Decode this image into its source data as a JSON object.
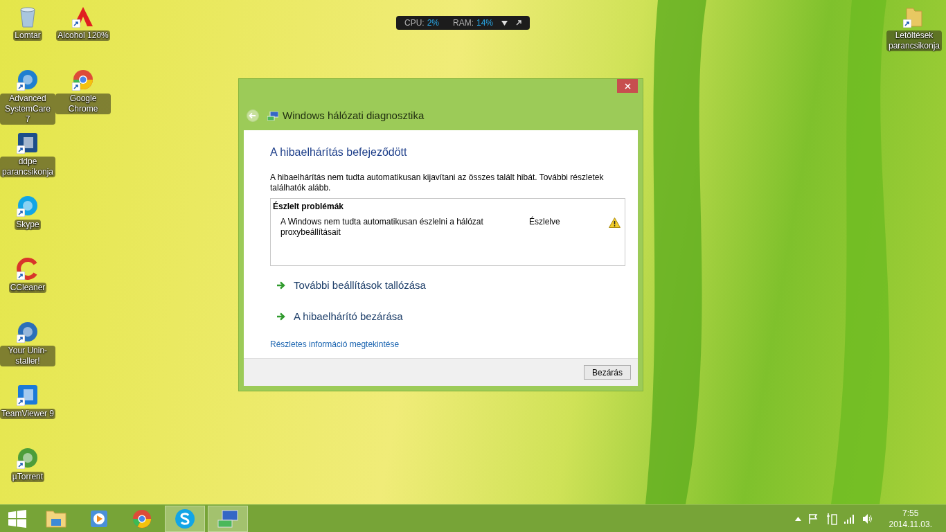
{
  "desktop": {
    "icon_columns": [
      [
        {
          "label": "Lomtar",
          "kind": "bin",
          "color": "#a9c6de",
          "shortcut": false
        },
        {
          "label": "Advanced SystemCare 7",
          "kind": "circle",
          "color": "#1f7fd0",
          "shortcut": true
        },
        {
          "label": "ddpe parancsikonja",
          "kind": "square",
          "color": "#1d4f8a",
          "shortcut": true
        },
        {
          "label": "Skype",
          "kind": "circle",
          "color": "#12a5e6",
          "shortcut": true
        },
        {
          "label": "CCleaner",
          "kind": "ring",
          "color": "#d8352a",
          "shortcut": true
        },
        {
          "label": "Your Unin-staller!",
          "kind": "circle",
          "color": "#2b6fb8",
          "shortcut": true
        },
        {
          "label": "TeamViewer 9",
          "kind": "square",
          "color": "#1c7ad8",
          "shortcut": true
        },
        {
          "label": "µTorrent",
          "kind": "circle",
          "color": "#4c9d3a",
          "shortcut": true
        }
      ],
      [
        {
          "label": "Alcohol 120%",
          "kind": "letter",
          "color": "#e02020",
          "shortcut": true
        },
        {
          "label": "Google Chrome",
          "kind": "chrome",
          "color": "#dd4b39",
          "shortcut": true
        }
      ]
    ],
    "right_icons": [
      {
        "label": "Letöltések parancsikonja",
        "kind": "folder",
        "color": "#e8c862",
        "shortcut": true
      }
    ]
  },
  "monitor": {
    "cpu_label": "CPU:",
    "cpu_value": "2%",
    "ram_label": "RAM:",
    "ram_value": "14%"
  },
  "window": {
    "title": "Windows hálózati diagnosztika",
    "heading": "A hibaelhárítás befejeződött",
    "message": "A hibaelhárítás nem tudta automatikusan kijavítani az összes talált hibát. További részletek találhatók alább.",
    "problems": {
      "header": "Észlelt problémák",
      "rows": [
        {
          "text": "A Windows nem tudta automatikusan észlelni a hálózat proxybeállításait",
          "status": "Észlelve"
        }
      ]
    },
    "options": [
      "További beállítások tallózása",
      "A hibaelhárító bezárása"
    ],
    "details_link": "Részletes információ megtekintése",
    "buttons": [
      "Bezárás"
    ]
  },
  "taskbar": {
    "items": [
      {
        "kind": "folder",
        "active": false
      },
      {
        "kind": "media",
        "active": false
      },
      {
        "kind": "chrome",
        "active": false
      },
      {
        "kind": "skype",
        "active": true
      },
      {
        "kind": "network",
        "active": true
      }
    ],
    "time": "7:55",
    "date": "2014.11.03."
  }
}
